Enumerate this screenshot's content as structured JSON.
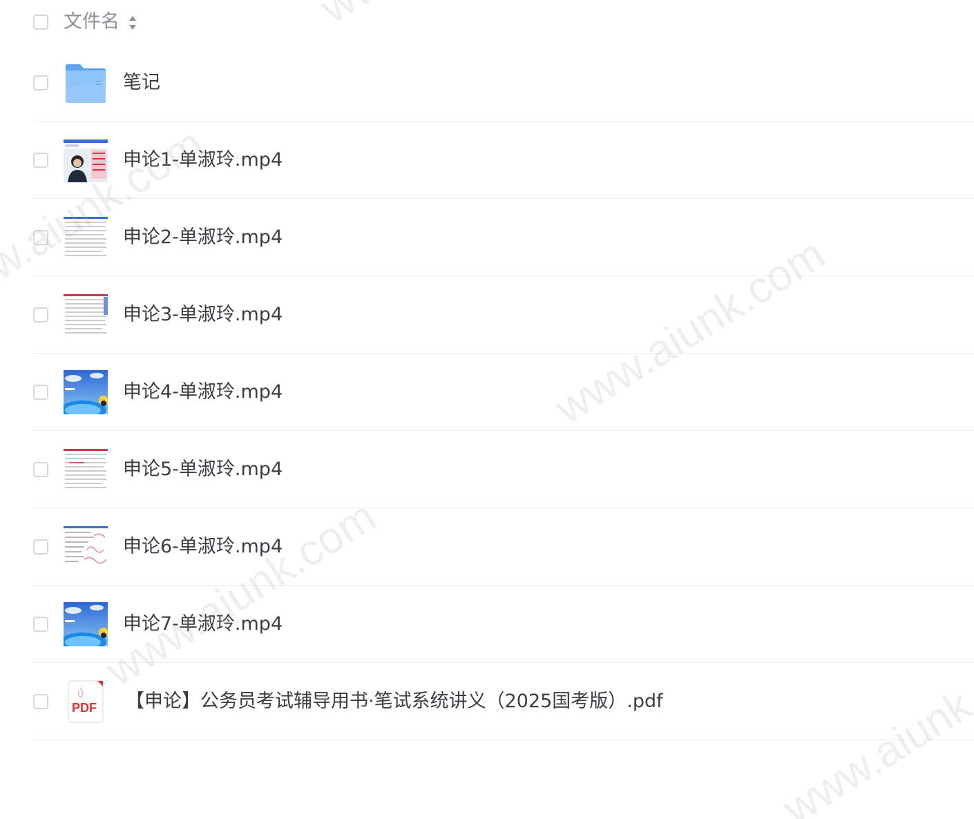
{
  "header": {
    "column_label": "文件名",
    "sort_icon": "sort-icon"
  },
  "files": [
    {
      "name": "笔记",
      "icon": "folder-icon",
      "type": "folder"
    },
    {
      "name": "申论1-单淑玲.mp4",
      "icon": "video-thumbnail-person",
      "type": "video"
    },
    {
      "name": "申论2-单淑玲.mp4",
      "icon": "video-thumbnail-document",
      "type": "video"
    },
    {
      "name": "申论3-单淑玲.mp4",
      "icon": "video-thumbnail-document",
      "type": "video"
    },
    {
      "name": "申论4-单淑玲.mp4",
      "icon": "video-thumbnail-sky",
      "type": "video"
    },
    {
      "name": "申论5-单淑玲.mp4",
      "icon": "video-thumbnail-document",
      "type": "video"
    },
    {
      "name": "申论6-单淑玲.mp4",
      "icon": "video-thumbnail-document",
      "type": "video"
    },
    {
      "name": "申论7-单淑玲.mp4",
      "icon": "video-thumbnail-sky",
      "type": "video"
    },
    {
      "name": "【申论】公务员考试辅导用书·笔试系统讲义（2025国考版）.pdf",
      "icon": "pdf-file-icon",
      "type": "pdf",
      "badge": "PDF"
    }
  ],
  "watermark": "www.aiunk.com",
  "colors": {
    "folder": "#7cb8f7",
    "pdf_badge": "#e0322e",
    "divider": "#eceef1",
    "checkbox_border": "#d6d8dc"
  }
}
